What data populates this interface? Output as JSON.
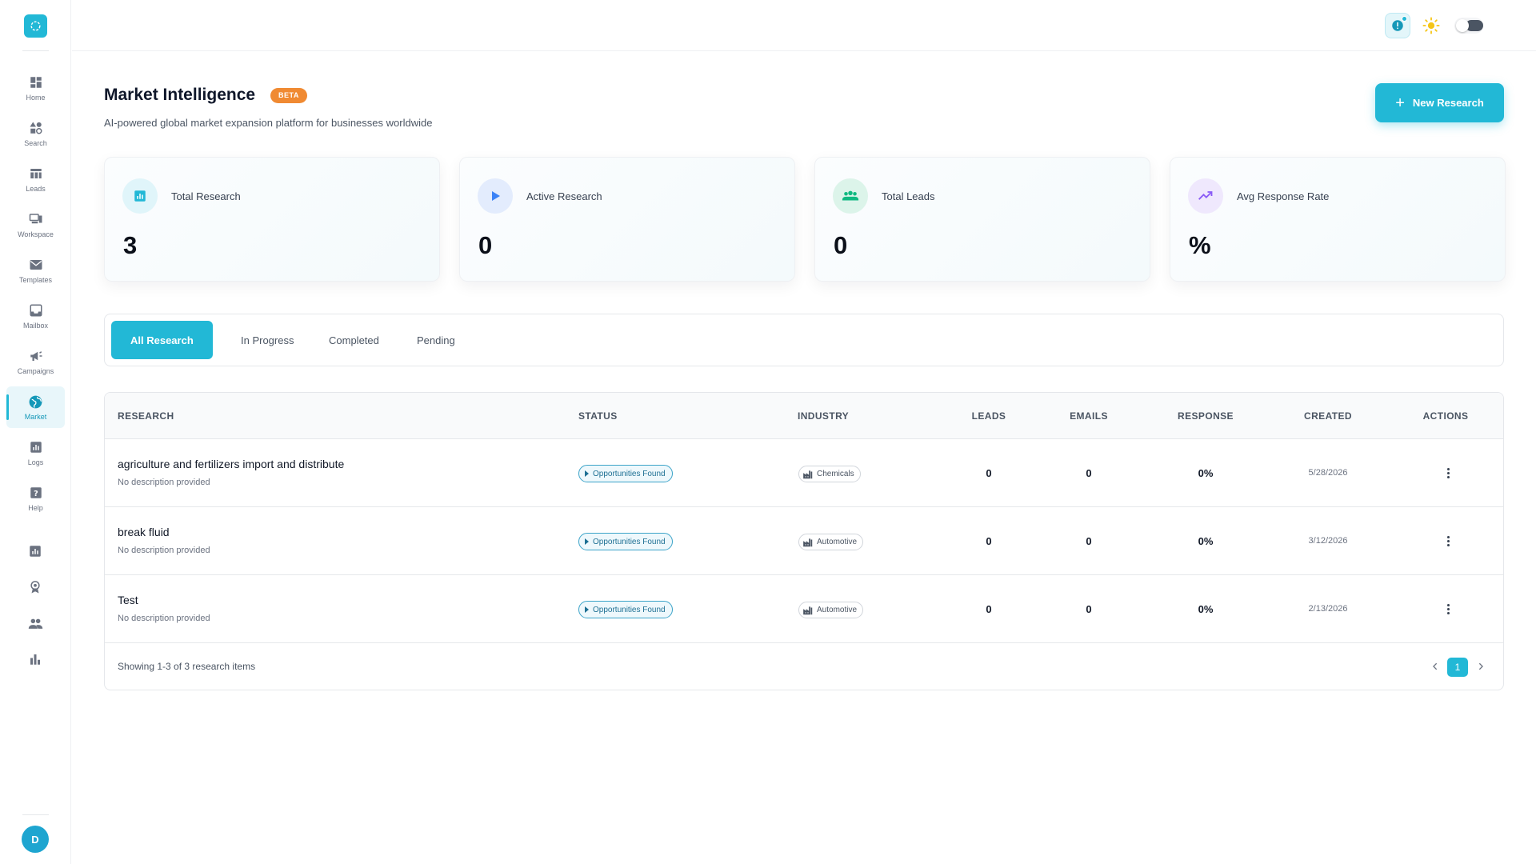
{
  "sidebar": {
    "items": [
      {
        "label": "Home",
        "icon": "dashboard-grid-icon"
      },
      {
        "label": "Search",
        "icon": "search-shapes-icon"
      },
      {
        "label": "Leads",
        "icon": "table-icon"
      },
      {
        "label": "Workspace",
        "icon": "workspace-icon"
      },
      {
        "label": "Templates",
        "icon": "envelope-icon"
      },
      {
        "label": "Mailbox",
        "icon": "inbox-icon"
      },
      {
        "label": "Campaigns",
        "icon": "megaphone-icon"
      },
      {
        "label": "Market",
        "icon": "globe-icon",
        "active": true
      },
      {
        "label": "Logs",
        "icon": "chart-box-icon"
      },
      {
        "label": "Help",
        "icon": "help-box-icon"
      }
    ],
    "extra_icons": [
      "analytics-box-icon",
      "award-icon",
      "people-icon",
      "bar-chart-icon"
    ],
    "avatar_initial": "D"
  },
  "topbar": {
    "notification_icon": "notification-icon",
    "theme_light_icon": "sun-icon",
    "theme_dark_icon": "moon-icon"
  },
  "header": {
    "title": "Market Intelligence",
    "badge": "BETA",
    "subtitle": "AI-powered global market expansion platform for businesses worldwide",
    "new_research_label": "New Research"
  },
  "stats": [
    {
      "label": "Total Research",
      "value": "3",
      "icon": "report-icon",
      "icon_color": "#22b8d6"
    },
    {
      "label": "Active Research",
      "value": "0",
      "icon": "play-icon",
      "icon_color": "#3b82f6"
    },
    {
      "label": "Total Leads",
      "value": "0",
      "icon": "people-icon",
      "icon_color": "#10b981"
    },
    {
      "label": "Avg Response Rate",
      "value": "%",
      "icon": "trending-up-icon",
      "icon_color": "#8b5cf6"
    }
  ],
  "tabs": [
    {
      "label": "All Research",
      "active": true
    },
    {
      "label": "In Progress"
    },
    {
      "label": "Completed"
    },
    {
      "label": "Pending"
    }
  ],
  "table": {
    "columns": [
      "RESEARCH",
      "STATUS",
      "INDUSTRY",
      "LEADS",
      "EMAILS",
      "RESPONSE",
      "CREATED",
      "ACTIONS"
    ],
    "rows": [
      {
        "title": "agriculture and fertilizers import and distribute",
        "description": "No description provided",
        "status": "Opportunities Found",
        "industry": "Chemicals",
        "leads": "0",
        "emails": "0",
        "response": "0%",
        "created": "5/28/2026"
      },
      {
        "title": "break fluid",
        "description": "No description provided",
        "status": "Opportunities Found",
        "industry": "Automotive",
        "leads": "0",
        "emails": "0",
        "response": "0%",
        "created": "3/12/2026"
      },
      {
        "title": "Test",
        "description": "No description provided",
        "status": "Opportunities Found",
        "industry": "Automotive",
        "leads": "0",
        "emails": "0",
        "response": "0%",
        "created": "2/13/2026"
      }
    ],
    "footer_text": "Showing 1-3 of 3 research items",
    "current_page": "1"
  },
  "colors": {
    "accent": "#22b8d6",
    "beta": "#f08a32"
  }
}
